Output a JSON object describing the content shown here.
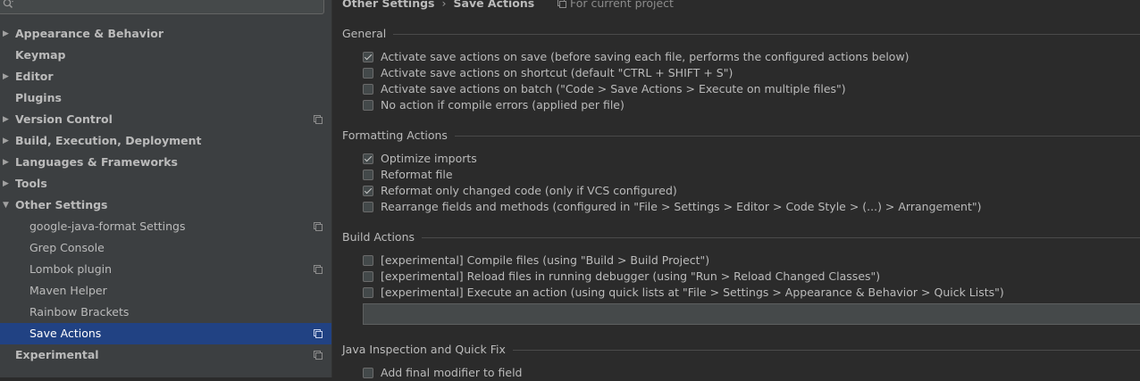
{
  "search": {
    "value": ""
  },
  "sidebar": {
    "items": [
      {
        "label": "Appearance & Behavior",
        "level": "top",
        "arrow": "▶",
        "project": false,
        "selected": false
      },
      {
        "label": "Keymap",
        "level": "top",
        "arrow": "",
        "project": false,
        "selected": false
      },
      {
        "label": "Editor",
        "level": "top",
        "arrow": "▶",
        "project": false,
        "selected": false
      },
      {
        "label": "Plugins",
        "level": "top",
        "arrow": "",
        "project": false,
        "selected": false
      },
      {
        "label": "Version Control",
        "level": "top",
        "arrow": "▶",
        "project": true,
        "selected": false
      },
      {
        "label": "Build, Execution, Deployment",
        "level": "top",
        "arrow": "▶",
        "project": false,
        "selected": false
      },
      {
        "label": "Languages & Frameworks",
        "level": "top",
        "arrow": "▶",
        "project": false,
        "selected": false
      },
      {
        "label": "Tools",
        "level": "top",
        "arrow": "▶",
        "project": false,
        "selected": false
      },
      {
        "label": "Other Settings",
        "level": "top",
        "arrow": "▼",
        "project": false,
        "selected": false
      },
      {
        "label": "google-java-format Settings",
        "level": "child",
        "arrow": "",
        "project": true,
        "selected": false
      },
      {
        "label": "Grep Console",
        "level": "child",
        "arrow": "",
        "project": false,
        "selected": false
      },
      {
        "label": "Lombok plugin",
        "level": "child",
        "arrow": "",
        "project": true,
        "selected": false
      },
      {
        "label": "Maven Helper",
        "level": "child",
        "arrow": "",
        "project": false,
        "selected": false
      },
      {
        "label": "Rainbow Brackets",
        "level": "child",
        "arrow": "",
        "project": false,
        "selected": false
      },
      {
        "label": "Save Actions",
        "level": "child",
        "arrow": "",
        "project": true,
        "selected": true
      },
      {
        "label": "Experimental",
        "level": "top",
        "arrow": "",
        "project": true,
        "selected": false
      }
    ]
  },
  "breadcrumb": {
    "parent": "Other Settings",
    "separator": "›",
    "current": "Save Actions"
  },
  "scope_label": "For current project",
  "sections": {
    "general": {
      "title": "General",
      "options": [
        {
          "label": "Activate save actions on save (before saving each file, performs the configured actions below)",
          "checked": true
        },
        {
          "label": "Activate save actions on shortcut (default \"CTRL + SHIFT + S\")",
          "checked": false
        },
        {
          "label": "Activate save actions on batch (\"Code > Save Actions > Execute on multiple files\")",
          "checked": false
        },
        {
          "label": "No action if compile errors (applied per file)",
          "checked": false
        }
      ]
    },
    "formatting": {
      "title": "Formatting Actions",
      "options": [
        {
          "label": "Optimize imports",
          "checked": true
        },
        {
          "label": "Reformat file",
          "checked": false
        },
        {
          "label": "Reformat only changed code (only if VCS configured)",
          "checked": true
        },
        {
          "label": "Rearrange fields and methods (configured in \"File > Settings > Editor > Code Style > (...) > Arrangement\")",
          "checked": false
        }
      ]
    },
    "build": {
      "title": "Build Actions",
      "options": [
        {
          "label": "[experimental] Compile files (using \"Build > Build Project\")",
          "checked": false
        },
        {
          "label": "[experimental] Reload files in running debugger (using \"Run > Reload Changed Classes\")",
          "checked": false
        },
        {
          "label": "[experimental] Execute an action (using quick lists at \"File > Settings > Appearance & Behavior > Quick Lists\")",
          "checked": false
        }
      ],
      "action_value": ""
    },
    "java": {
      "title": "Java Inspection and Quick Fix",
      "options": [
        {
          "label": "Add final modifier to field",
          "checked": false
        }
      ]
    }
  },
  "colors": {
    "selection": "#214283",
    "sidebar_bg": "#3c3f41",
    "main_bg": "#2b2b2b"
  }
}
